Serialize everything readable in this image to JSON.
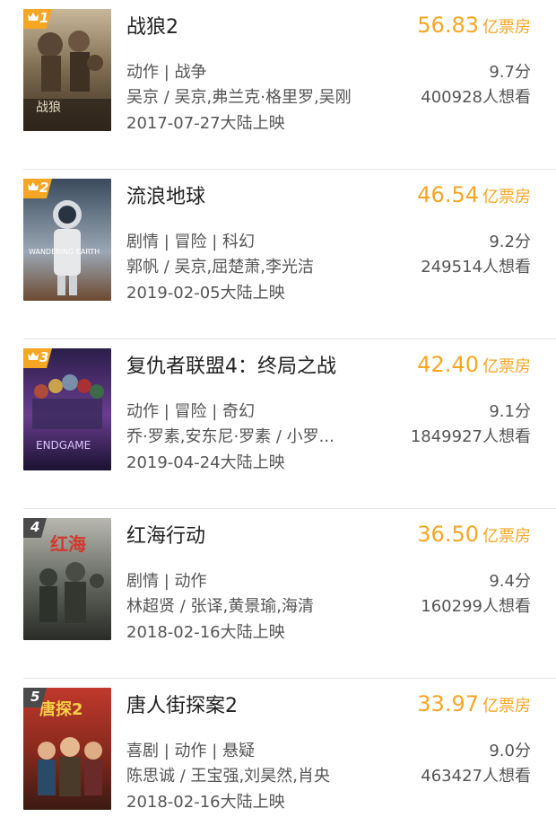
{
  "unit_label": "亿票房",
  "colors": {
    "gross": "#f5a623",
    "rank_top3": "#f5a623",
    "rank_other": "#4a4a4a"
  },
  "movies": [
    {
      "rank": "1",
      "title": "战狼2",
      "gross": "56.83",
      "genre": "动作 | 战争",
      "score": "9.7分",
      "cast": "吴京 / 吴京,弗兰克·格里罗,吴刚",
      "want": "400928人想看",
      "date": "2017-07-27大陆上映",
      "poster_text": "战狼"
    },
    {
      "rank": "2",
      "title": "流浪地球",
      "gross": "46.54",
      "genre": "剧情 | 冒险 | 科幻",
      "score": "9.2分",
      "cast": "郭帆 / 吴京,屈楚萧,李光洁",
      "want": "249514人想看",
      "date": "2019-02-05大陆上映",
      "poster_text": "WANDERING EARTH"
    },
    {
      "rank": "3",
      "title": "复仇者联盟4：终局之战",
      "gross": "42.40",
      "genre": "动作 | 冒险 | 奇幻",
      "score": "9.1分",
      "cast": "乔·罗素,安东尼·罗素 / 小罗...",
      "want": "1849927人想看",
      "date": "2019-04-24大陆上映",
      "poster_text": "ENDGAME"
    },
    {
      "rank": "4",
      "title": "红海行动",
      "gross": "36.50",
      "genre": "剧情 | 动作",
      "score": "9.4分",
      "cast": "林超贤 / 张译,黄景瑜,海清",
      "want": "160299人想看",
      "date": "2018-02-16大陆上映",
      "poster_text": "红海"
    },
    {
      "rank": "5",
      "title": "唐人街探案2",
      "gross": "33.97",
      "genre": "喜剧 | 动作 | 悬疑",
      "score": "9.0分",
      "cast": "陈思诚 / 王宝强,刘昊然,肖央",
      "want": "463427人想看",
      "date": "2018-02-16大陆上映",
      "poster_text": "唐探2"
    }
  ]
}
